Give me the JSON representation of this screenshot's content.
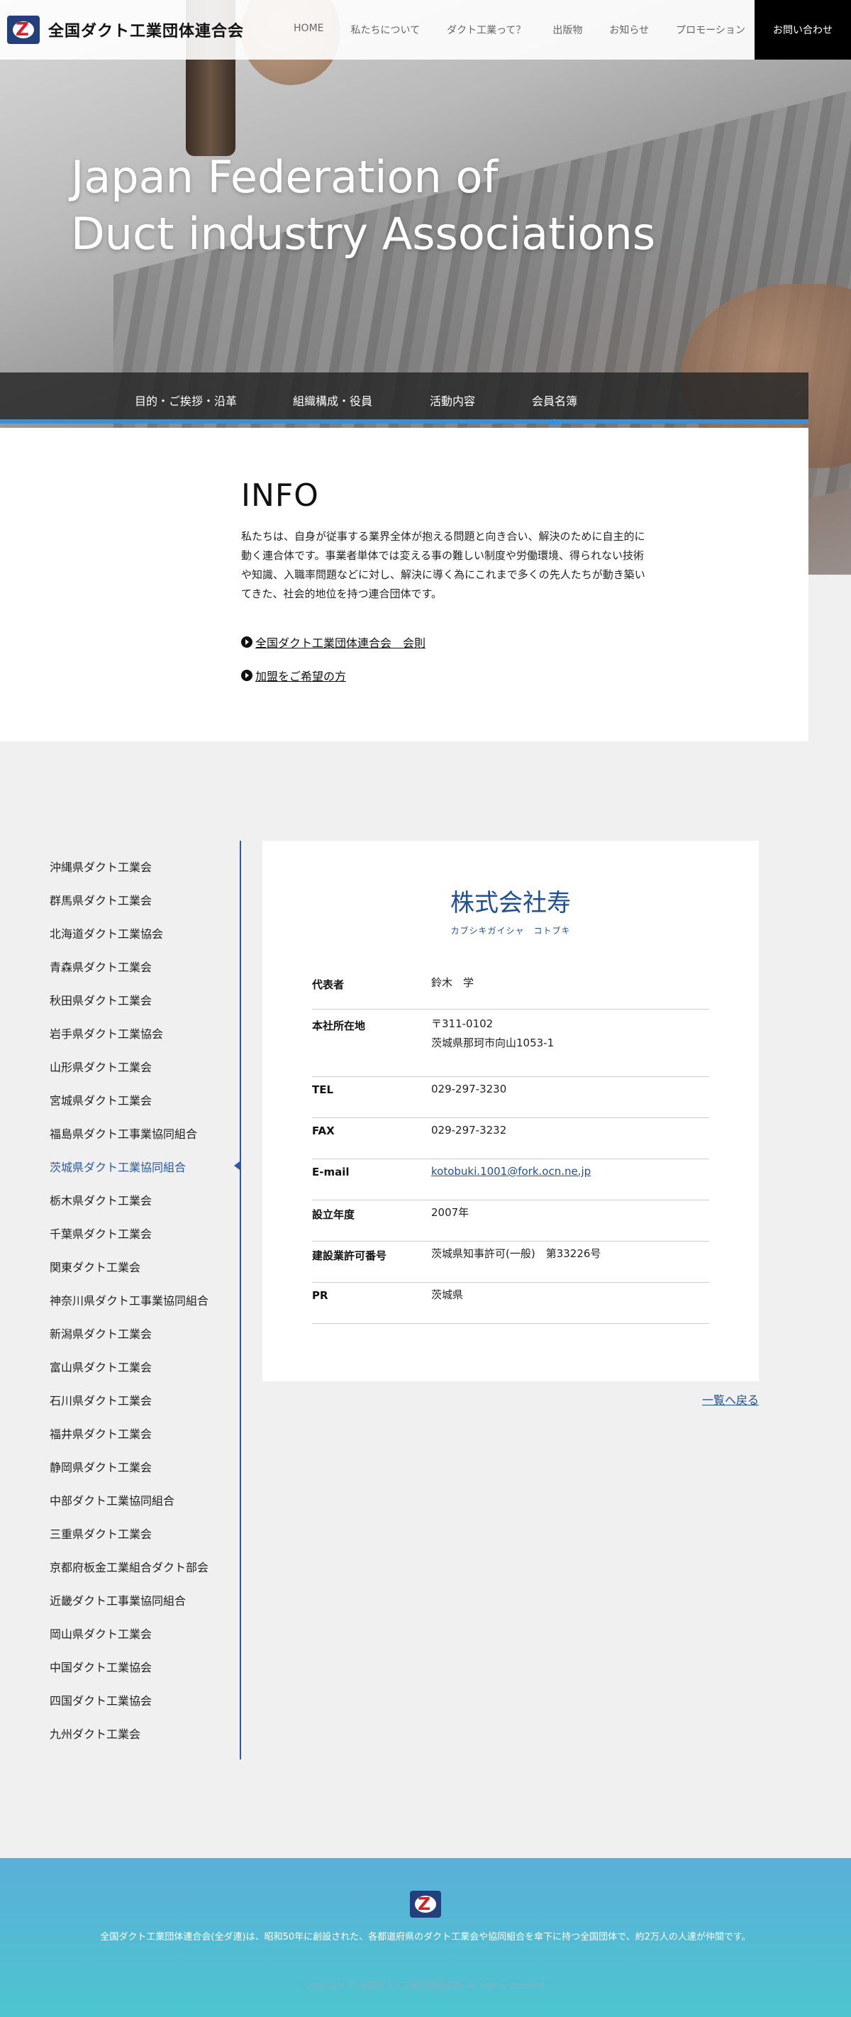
{
  "header": {
    "logo_text": "全国ダクト工業団体連合会",
    "nav": [
      "HOME",
      "私たちについて",
      "ダクト工業って？",
      "出版物",
      "お知らせ",
      "プロモーション"
    ],
    "contact": "お問い合わせ"
  },
  "hero": {
    "title_line1": "Japan Federation of",
    "title_line2": "Duct industry Associations"
  },
  "subnav": [
    "目的・ご挨拶・沿革",
    "組織構成・役員",
    "活動内容",
    "会員名簿"
  ],
  "info": {
    "title": "INFO",
    "text": "私たちは、自身が従事する業界全体が抱える問題と向き合い、解決のために自主的に動く連合体です。事業者単体では変える事の難しい制度や労働環境、得られない技術や知識、入職率問題などに対し、解決に導く為にこれまで多くの先人たちが動き築いてきた、社会的地位を持つ連合団体です。",
    "links": [
      "全国ダクト工業団体連合会　会則",
      "加盟をご希望の方"
    ]
  },
  "sidebar": {
    "items": [
      "沖縄県ダクト工業会",
      "群馬県ダクト工業会",
      "北海道ダクト工業協会",
      "青森県ダクト工業会",
      "秋田県ダクト工業会",
      "岩手県ダクト工業協会",
      "山形県ダクト工業会",
      "宮城県ダクト工業会",
      "福島県ダクト工事業協同組合",
      "茨城県ダクト工業協同組合",
      "栃木県ダクト工業会",
      "千葉県ダクト工業会",
      "関東ダクト工業会",
      "神奈川県ダクト工事業協同組合",
      "新潟県ダクト工業会",
      "富山県ダクト工業会",
      "石川県ダクト工業会",
      "福井県ダクト工業会",
      "静岡県ダクト工業会",
      "中部ダクト工業協同組合",
      "三重県ダクト工業会",
      "京都府板金工業組合ダクト部会",
      "近畿ダクト工事業協同組合",
      "岡山県ダクト工業会",
      "中国ダクト工業協会",
      "四国ダクト工業協会",
      "九州ダクト工業会"
    ]
  },
  "company": {
    "name": "株式会社寿",
    "kana": "カブシキガイシャ　コトブキ",
    "rows": [
      {
        "label": "代表者",
        "value": "鈴木　学"
      },
      {
        "label": "本社所在地",
        "value": "〒311-0102",
        "value2": "茨城県那珂市向山1053-1"
      },
      {
        "label": "TEL",
        "value": "029-297-3230"
      },
      {
        "label": "FAX",
        "value": "029-297-3232"
      },
      {
        "label": "E-mail",
        "value": "kotobuki.1001@fork.ocn.ne.jp"
      },
      {
        "label": "設立年度",
        "value": "2007年"
      },
      {
        "label": "建設業許可番号",
        "value": "茨城県知事許可(一般)　第33226号"
      },
      {
        "label": "PR",
        "value": "茨城県"
      }
    ],
    "back": "一覧へ戻る"
  },
  "footer": {
    "text": "全国ダクト工業団体連合会(全ダ連)は、昭和50年に創設された、各都道府県のダクト工業会や協同組合を傘下に持つ全国団体で、約2万人の人達が仲間です。",
    "copyright": "Copyright © 全国ダクト工業団体連合会. All rights reserved."
  }
}
